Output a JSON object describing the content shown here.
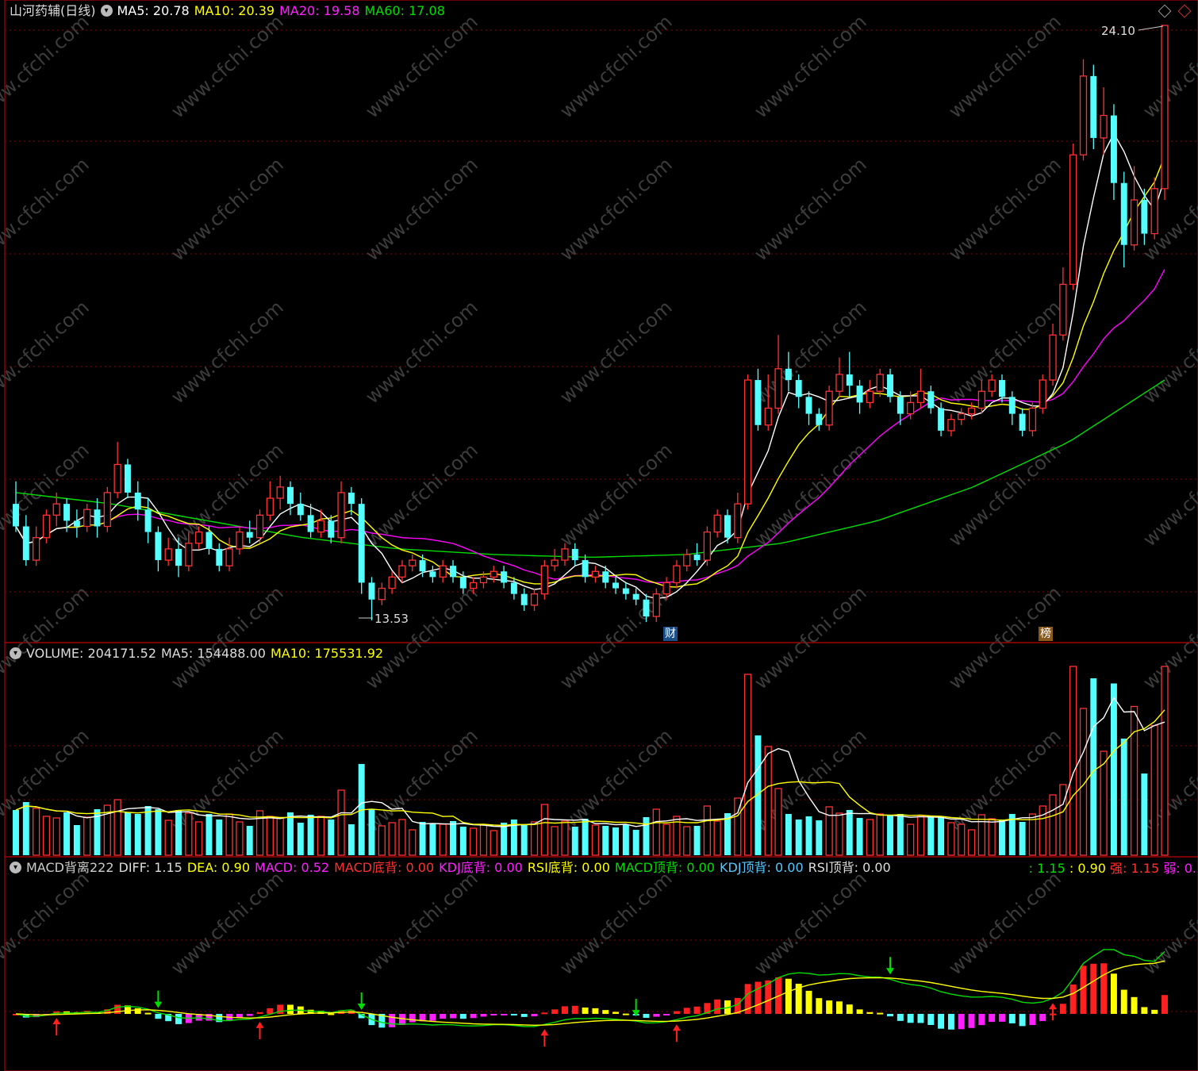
{
  "main_header": {
    "stock_name": "山河药辅(日线)",
    "ma5": "MA5: 20.78",
    "ma10": "MA10: 20.39",
    "ma20": "MA20: 19.58",
    "ma60": "MA60: 17.08"
  },
  "volume_header": {
    "volume": "VOLUME: 204171.52",
    "ma5": "MA5: 154488.00",
    "ma10": "MA10: 175531.92"
  },
  "macd_header": {
    "name": "MACD背离222",
    "diff": "DIFF: 1.15",
    "dea": "DEA: 0.90",
    "macd": "MACD: 0.52",
    "macd_bottom": "MACD底背: 0.00",
    "kdj_bottom": "KDJ底背: 0.00",
    "rsi_bottom": "RSI底背: 0.00",
    "macd_top": "MACD顶背: 0.00",
    "kdj_top": "KDJ顶背: 0.00",
    "rsi_top": "RSI顶背: 0.00"
  },
  "macd_right": {
    "v1": ": 1.15",
    "v2": ": 0.90",
    "strong": "强: 1.15",
    "weak": "弱: 0."
  },
  "annotations": {
    "high_label": "24.10",
    "low_label": "13.53",
    "cai_tag": "财",
    "bang_tag": "榜"
  },
  "watermark": "www.cfchi.com",
  "colors": {
    "up": "#ff3232",
    "down": "#54ffff",
    "ma5": "#ffffff",
    "ma10": "#ffff00",
    "ma20": "#ff00ff",
    "ma60": "#00dd00",
    "grid": "#8b0000",
    "frame": "#b00000",
    "macd_up": "#ff2020",
    "macd_down": "#54ffff",
    "macd_yellow": "#ffff00",
    "macd_magenta": "#ff20ff"
  },
  "chart_data": {
    "type": "candlestick",
    "price_range": [
      13.53,
      24.1
    ],
    "bars": [
      [
        15.6,
        15.2,
        16.0,
        15.1
      ],
      [
        15.2,
        14.6,
        15.4,
        14.5
      ],
      [
        14.6,
        15.0,
        15.2,
        14.5
      ],
      [
        15.0,
        15.4,
        15.5,
        14.9
      ],
      [
        15.4,
        15.6,
        15.8,
        15.2
      ],
      [
        15.6,
        15.3,
        15.7,
        15.1
      ],
      [
        15.3,
        15.2,
        15.5,
        15.0
      ],
      [
        15.2,
        15.5,
        15.6,
        15.1
      ],
      [
        15.5,
        15.2,
        15.7,
        15.0
      ],
      [
        15.2,
        15.8,
        15.9,
        15.1
      ],
      [
        15.8,
        16.3,
        16.7,
        15.7
      ],
      [
        16.3,
        15.8,
        16.4,
        15.7
      ],
      [
        15.8,
        15.5,
        16.0,
        15.3
      ],
      [
        15.5,
        15.1,
        15.7,
        14.9
      ],
      [
        15.1,
        14.6,
        15.2,
        14.4
      ],
      [
        14.6,
        14.8,
        15.0,
        14.5
      ],
      [
        14.8,
        14.5,
        15.0,
        14.3
      ],
      [
        14.5,
        14.9,
        15.1,
        14.4
      ],
      [
        14.9,
        15.1,
        15.2,
        14.8
      ],
      [
        15.1,
        14.8,
        15.2,
        14.7
      ],
      [
        14.8,
        14.5,
        14.9,
        14.4
      ],
      [
        14.5,
        14.8,
        15.0,
        14.4
      ],
      [
        14.8,
        15.1,
        15.2,
        14.7
      ],
      [
        15.1,
        15.0,
        15.3,
        14.9
      ],
      [
        15.0,
        15.4,
        15.5,
        14.9
      ],
      [
        15.4,
        15.7,
        16.0,
        15.3
      ],
      [
        15.7,
        15.9,
        16.1,
        15.5
      ],
      [
        15.9,
        15.6,
        16.0,
        15.4
      ],
      [
        15.6,
        15.4,
        15.8,
        15.3
      ],
      [
        15.4,
        15.1,
        15.6,
        15.0
      ],
      [
        15.1,
        15.3,
        15.5,
        15.0
      ],
      [
        15.3,
        15.0,
        15.4,
        14.9
      ],
      [
        15.0,
        15.8,
        16.0,
        14.9
      ],
      [
        15.8,
        15.6,
        15.9,
        15.4
      ],
      [
        15.6,
        14.2,
        15.7,
        14.0
      ],
      [
        14.2,
        13.9,
        14.3,
        13.53
      ],
      [
        13.9,
        14.1,
        14.2,
        13.8
      ],
      [
        14.1,
        14.3,
        14.4,
        14.0
      ],
      [
        14.3,
        14.5,
        14.6,
        14.2
      ],
      [
        14.5,
        14.6,
        14.7,
        14.4
      ],
      [
        14.6,
        14.4,
        14.7,
        14.3
      ],
      [
        14.4,
        14.3,
        14.5,
        14.2
      ],
      [
        14.3,
        14.5,
        14.6,
        14.2
      ],
      [
        14.5,
        14.3,
        14.6,
        14.2
      ],
      [
        14.3,
        14.1,
        14.4,
        14.0
      ],
      [
        14.1,
        14.2,
        14.3,
        14.0
      ],
      [
        14.2,
        14.3,
        14.4,
        14.1
      ],
      [
        14.3,
        14.4,
        14.5,
        14.2
      ],
      [
        14.4,
        14.2,
        14.5,
        14.1
      ],
      [
        14.2,
        14.0,
        14.3,
        13.9
      ],
      [
        14.0,
        13.8,
        14.1,
        13.7
      ],
      [
        13.8,
        14.0,
        14.1,
        13.7
      ],
      [
        14.0,
        14.5,
        14.6,
        13.9
      ],
      [
        14.5,
        14.6,
        14.8,
        14.4
      ],
      [
        14.6,
        14.8,
        14.9,
        14.5
      ],
      [
        14.8,
        14.6,
        14.9,
        14.5
      ],
      [
        14.6,
        14.3,
        14.7,
        14.2
      ],
      [
        14.3,
        14.4,
        14.5,
        14.2
      ],
      [
        14.4,
        14.2,
        14.5,
        14.1
      ],
      [
        14.2,
        14.1,
        14.3,
        14.0
      ],
      [
        14.1,
        14.0,
        14.2,
        13.9
      ],
      [
        14.0,
        13.9,
        14.1,
        13.8
      ],
      [
        13.9,
        13.6,
        14.0,
        13.5
      ],
      [
        13.6,
        14.0,
        14.1,
        13.5
      ],
      [
        14.0,
        14.2,
        14.3,
        13.9
      ],
      [
        14.2,
        14.5,
        14.6,
        14.1
      ],
      [
        14.5,
        14.7,
        14.8,
        14.4
      ],
      [
        14.7,
        14.6,
        14.9,
        14.5
      ],
      [
        14.6,
        15.1,
        15.2,
        14.5
      ],
      [
        15.1,
        15.4,
        15.5,
        15.0
      ],
      [
        15.4,
        15.0,
        15.5,
        14.9
      ],
      [
        15.0,
        15.6,
        15.8,
        14.9
      ],
      [
        15.6,
        17.8,
        17.9,
        15.5
      ],
      [
        17.8,
        17.0,
        18.0,
        16.9
      ],
      [
        17.0,
        17.3,
        17.9,
        16.9
      ],
      [
        17.3,
        18.0,
        18.6,
        17.2
      ],
      [
        18.0,
        17.8,
        18.3,
        17.6
      ],
      [
        17.8,
        17.5,
        17.9,
        17.3
      ],
      [
        17.5,
        17.2,
        17.6,
        17.0
      ],
      [
        17.2,
        17.0,
        17.3,
        16.9
      ],
      [
        17.0,
        17.6,
        17.7,
        16.9
      ],
      [
        17.6,
        17.9,
        18.2,
        17.5
      ],
      [
        17.9,
        17.7,
        18.3,
        17.5
      ],
      [
        17.7,
        17.4,
        17.8,
        17.2
      ],
      [
        17.4,
        17.6,
        17.8,
        17.3
      ],
      [
        17.6,
        17.9,
        18.0,
        17.5
      ],
      [
        17.9,
        17.5,
        18.0,
        17.4
      ],
      [
        17.5,
        17.2,
        17.6,
        17.0
      ],
      [
        17.2,
        17.4,
        17.6,
        17.1
      ],
      [
        17.4,
        17.6,
        18.0,
        17.3
      ],
      [
        17.6,
        17.3,
        17.7,
        17.2
      ],
      [
        17.3,
        16.9,
        17.4,
        16.8
      ],
      [
        16.9,
        17.1,
        17.2,
        16.8
      ],
      [
        17.1,
        17.2,
        17.3,
        17.0
      ],
      [
        17.2,
        17.3,
        17.4,
        17.1
      ],
      [
        17.3,
        17.6,
        17.8,
        17.2
      ],
      [
        17.6,
        17.8,
        17.9,
        17.5
      ],
      [
        17.8,
        17.5,
        17.9,
        17.4
      ],
      [
        17.5,
        17.2,
        17.6,
        17.0
      ],
      [
        17.2,
        16.9,
        17.3,
        16.8
      ],
      [
        16.9,
        17.3,
        17.4,
        16.8
      ],
      [
        17.3,
        17.8,
        17.9,
        17.2
      ],
      [
        17.8,
        18.6,
        18.8,
        17.7
      ],
      [
        18.6,
        19.5,
        19.8,
        18.5
      ],
      [
        19.5,
        21.8,
        22.0,
        19.4
      ],
      [
        21.8,
        23.2,
        23.5,
        21.7
      ],
      [
        23.2,
        22.1,
        23.4,
        21.9
      ],
      [
        22.1,
        22.5,
        23.0,
        21.8
      ],
      [
        22.5,
        21.3,
        22.7,
        21.0
      ],
      [
        21.3,
        20.2,
        21.5,
        19.8
      ],
      [
        20.2,
        21.0,
        21.6,
        20.1
      ],
      [
        21.0,
        20.4,
        21.2,
        20.2
      ],
      [
        20.4,
        21.2,
        21.4,
        20.3
      ],
      [
        21.2,
        24.1,
        24.1,
        21.0
      ]
    ]
  }
}
